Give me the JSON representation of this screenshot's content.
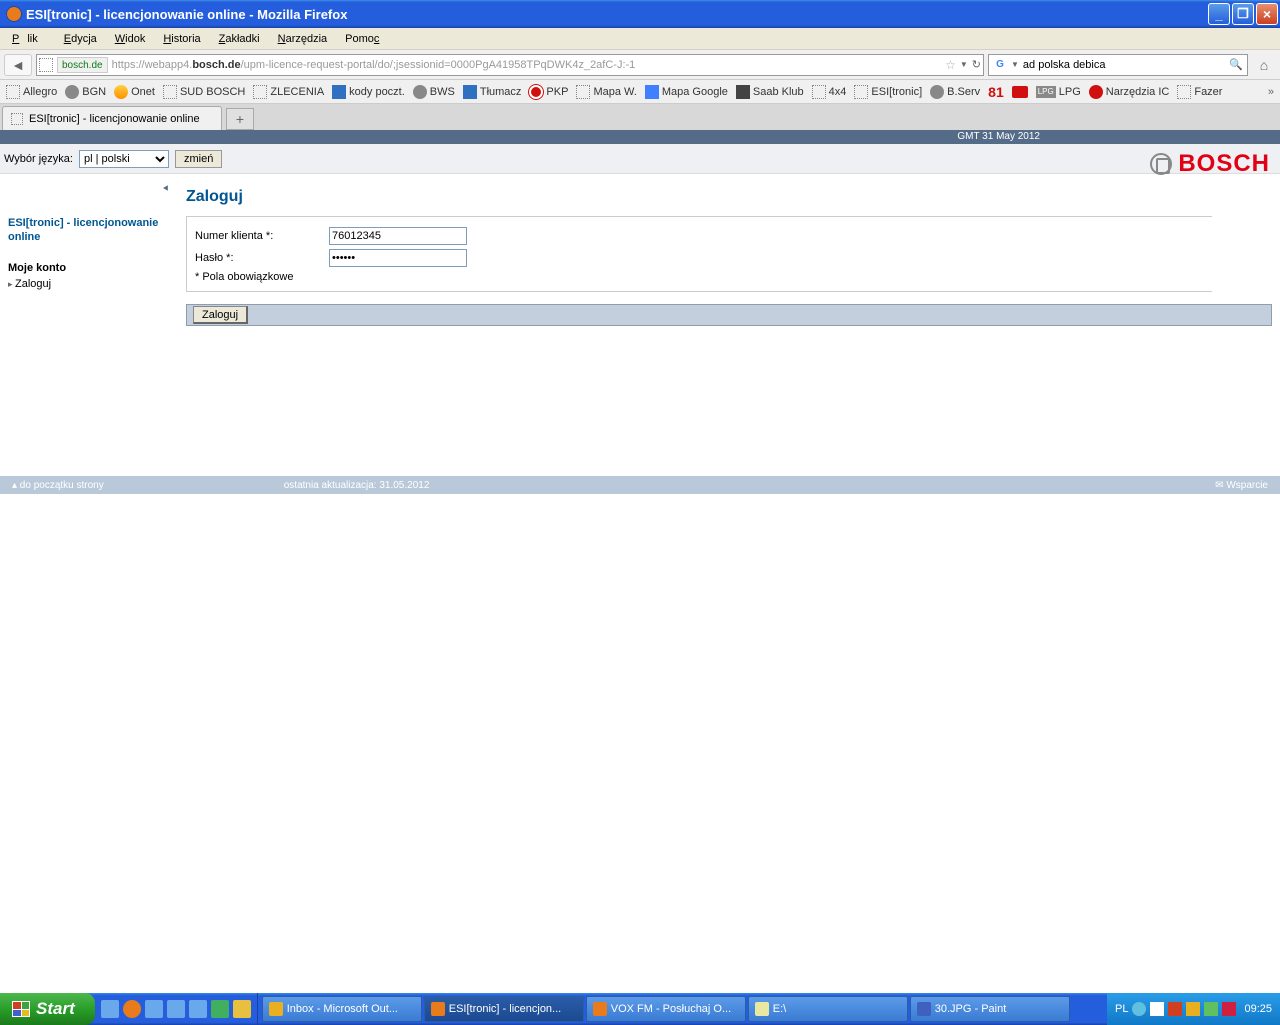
{
  "window": {
    "title": "ESI[tronic] - licencjonowanie online - Mozilla Firefox"
  },
  "menu": {
    "file": "Plik",
    "edit": "Edycja",
    "view": "Widok",
    "history": "Historia",
    "bookmarks": "Zakładki",
    "tools": "Narzędzia",
    "help": "Pomoc"
  },
  "urlbar": {
    "site": "bosch.de",
    "url_prefix": "https://webapp4.",
    "url_host": "bosch.de",
    "url_path": "/upm-licence-request-portal/do/;jsessionid=0000PgA41958TPqDWK4z_2afC-J:-1",
    "search_value": "ad polska debica"
  },
  "bookmarks": [
    "Allegro",
    "BGN",
    "Onet",
    "SUD BOSCH",
    "ZLECENIA",
    "kody poczt.",
    "BWS",
    "Tłumacz",
    "PKP",
    "Mapa W.",
    "Mapa Google",
    "Saab Klub",
    "4x4",
    "ESI[tronic]",
    "B.Serv",
    "81",
    "",
    "LPG",
    "Narzędzia IC",
    "Fazer"
  ],
  "tab": {
    "title": "ESI[tronic] - licencjonowanie online"
  },
  "page": {
    "gmt": "GMT 31 May 2012",
    "lang_label": "Wybór języka:",
    "lang_value": "pl | polski",
    "lang_btn": "zmień",
    "brand": "BOSCH",
    "sidebar": {
      "product": "ESI[tronic] - licencjonowanie online",
      "section": "Moje konto",
      "item": "Zaloguj"
    },
    "heading": "Zaloguj",
    "form": {
      "num_label": "Numer klienta *:",
      "num_value": "76012345",
      "pass_label": "Hasło *:",
      "pass_value": "••••••",
      "note": "* Pola obowiązkowe",
      "submit": "Zaloguj"
    },
    "footer": {
      "top": "▴ do początku strony",
      "update": "ostatnia aktualizacja: 31.05.2012",
      "support": "✉ Wsparcie"
    }
  },
  "taskbar": {
    "start": "Start",
    "items": [
      "Inbox - Microsoft Out...",
      "ESI[tronic] - licencjon...",
      "VOX FM - Posłuchaj O...",
      "E:\\",
      "30.JPG - Paint"
    ],
    "lang": "PL",
    "clock": "09:25"
  }
}
